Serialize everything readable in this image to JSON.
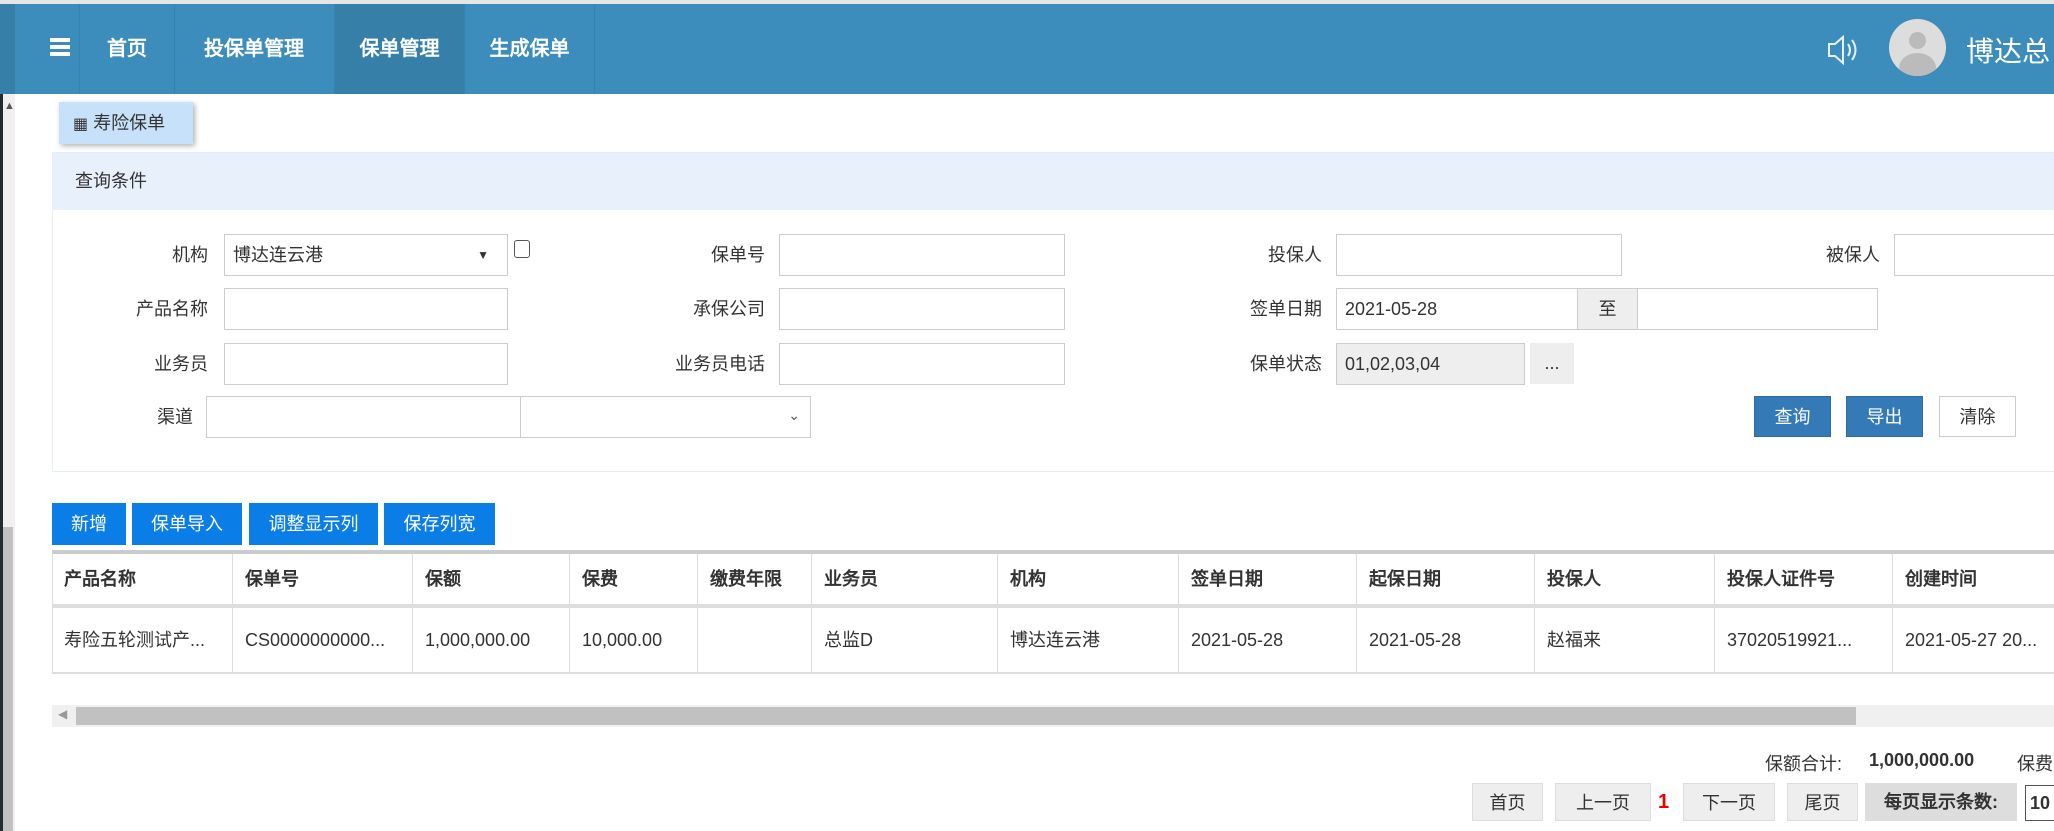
{
  "nav": {
    "items": [
      "首页",
      "投保单管理",
      "保单管理",
      "生成保单"
    ],
    "active": "保单管理",
    "user": "博达总"
  },
  "tab": {
    "label": "寿险保单"
  },
  "query": {
    "title": "查询条件",
    "org_label": "机构",
    "org_value": "博达连云港",
    "policy_no_label": "保单号",
    "applicant_label": "投保人",
    "insured_label": "被保人",
    "product_label": "产品名称",
    "company_label": "承保公司",
    "sign_date_label": "签单日期",
    "sign_date_from": "2021-05-28",
    "to_label": "至",
    "agent_label": "业务员",
    "agent_phone_label": "业务员电话",
    "status_label": "保单状态",
    "status_value": "01,02,03,04",
    "more_label": "...",
    "channel_label": "渠道",
    "search": "查询",
    "export": "导出",
    "clear": "清除"
  },
  "toolbar": [
    "新增",
    "保单导入",
    "调整显示列",
    "保存列宽"
  ],
  "table": {
    "columns": [
      "产品名称",
      "保单号",
      "保额",
      "保费",
      "缴费年限",
      "业务员",
      "机构",
      "签单日期",
      "起保日期",
      "投保人",
      "投保人证件号",
      "创建时间"
    ],
    "rows": [
      [
        "寿险五轮测试产...",
        "CS0000000000...",
        "1,000,000.00",
        "10,000.00",
        "",
        "总监D",
        "博达连云港",
        "2021-05-28",
        "2021-05-28",
        "赵福来",
        "37020519921...",
        "2021-05-27 20..."
      ]
    ]
  },
  "summary": {
    "amount_label": "保额合计:",
    "amount_value": "1,000,000.00",
    "premium_label": "保费"
  },
  "pager": {
    "first": "首页",
    "prev": "上一页",
    "current": "1",
    "next": "下一页",
    "last": "尾页",
    "size_label": "每页显示条数:",
    "size_value": "10"
  }
}
